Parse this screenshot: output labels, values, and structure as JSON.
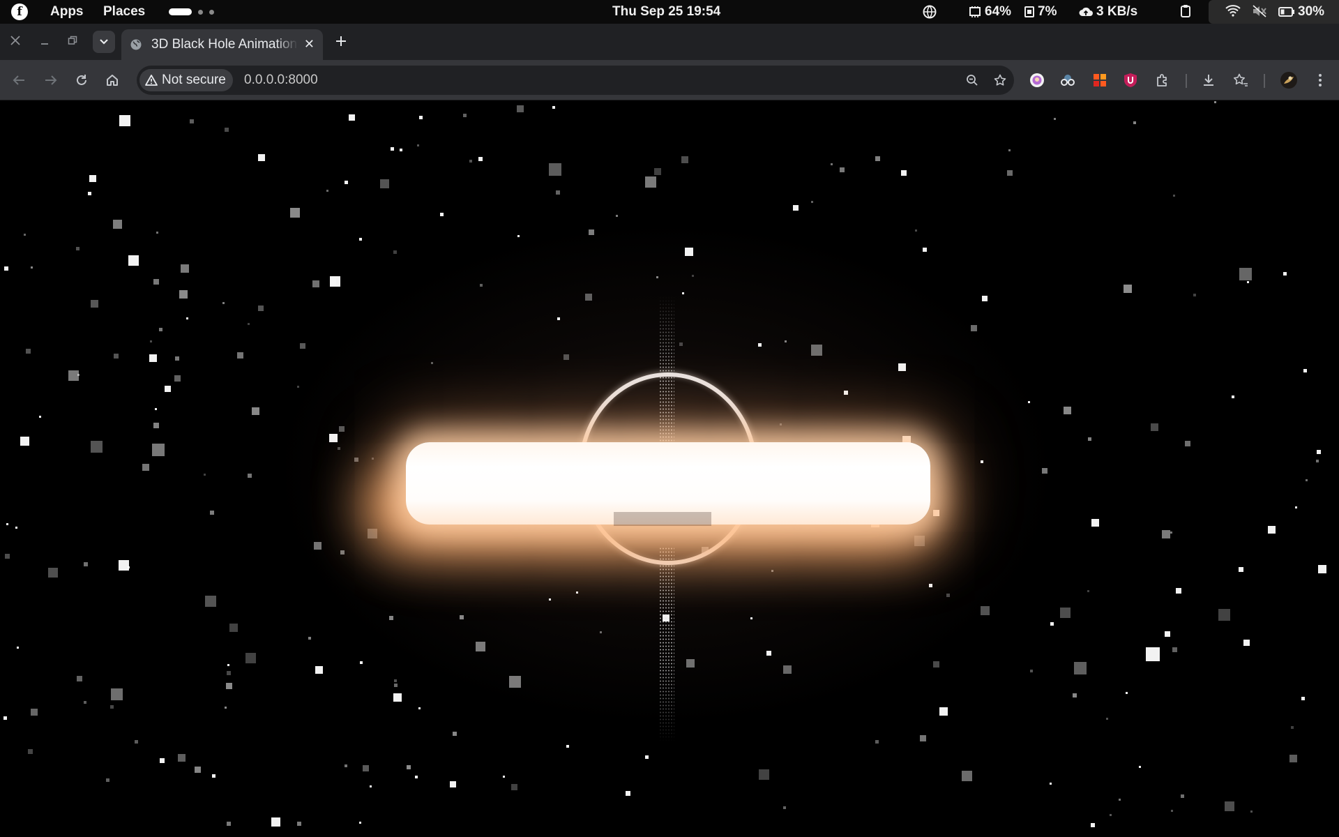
{
  "system_bar": {
    "menu_apps": "Apps",
    "menu_places": "Places",
    "clock": "Thu Sep 25  19:54",
    "cpu": "64%",
    "memory": "7%",
    "network": "3 KB/s",
    "battery": "30%"
  },
  "browser": {
    "tab_title": "3D Black Hole Animation",
    "security_label": "Not secure",
    "url": "0.0.0.0:8000"
  },
  "scene": {
    "background": "#000000",
    "disk_color": "#ffe9d6",
    "glow_color": "#ffb070",
    "ring_color": "#e9e4e2"
  }
}
